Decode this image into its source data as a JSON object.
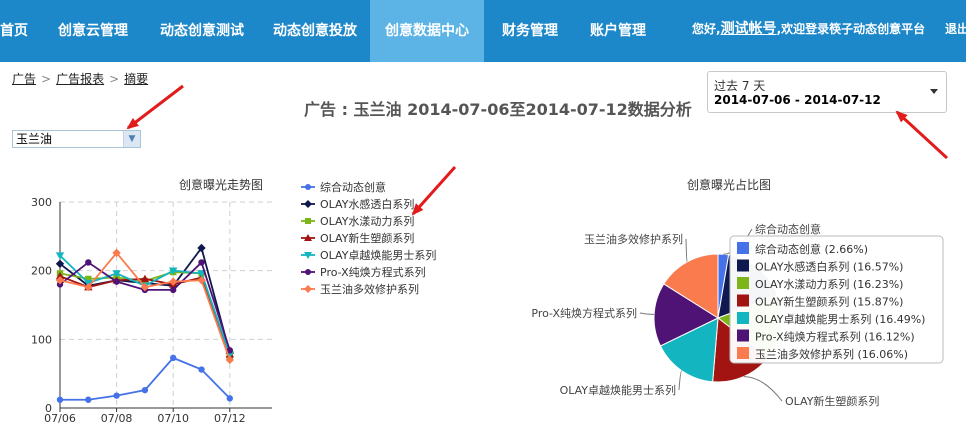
{
  "nav": {
    "items": [
      {
        "label": "首页"
      },
      {
        "label": "创意云管理"
      },
      {
        "label": "动态创意测试"
      },
      {
        "label": "动态创意投放"
      },
      {
        "label": "创意数据中心",
        "active": true
      },
      {
        "label": "财务管理"
      },
      {
        "label": "账户管理"
      }
    ],
    "greeting": "您好,",
    "account": "测试帐号",
    "welcome": ",欢迎登录筷子动态创意平台",
    "logout": "退出",
    "bar_color": "#1c87c9",
    "active_color": "#5cb4e6"
  },
  "breadcrumb": {
    "items": [
      "广告",
      "广告报表",
      "摘要"
    ],
    "separator": ">"
  },
  "page_title": "广告 : 玉兰油 2014-07-06至2014-07-12数据分析",
  "product_select": {
    "value": "玉兰油"
  },
  "date_range": {
    "preset": "过去 7 天",
    "range": "2014-07-06 - 2014-07-12"
  },
  "chart_data": [
    {
      "type": "line",
      "title": "创意曝光走势图",
      "x": [
        "07/06",
        "07/07",
        "07/08",
        "07/09",
        "07/10",
        "07/11",
        "07/12"
      ],
      "x_tick_labels": [
        "07/06",
        "07/08",
        "07/10",
        "07/12"
      ],
      "ylim": [
        0,
        300
      ],
      "y_ticks": [
        0,
        100,
        200,
        300
      ],
      "grid": true,
      "legend": "right",
      "series": [
        {
          "name": "综合动态创意",
          "color": "#4572e8",
          "marker": "circle",
          "values": [
            12,
            12,
            18,
            26,
            73,
            56,
            14
          ]
        },
        {
          "name": "OLAY水感透白系列",
          "color": "#10194f",
          "marker": "diamond",
          "values": [
            210,
            178,
            186,
            182,
            178,
            233,
            80
          ]
        },
        {
          "name": "OLAY水漾动力系列",
          "color": "#7bb51a",
          "marker": "square",
          "values": [
            196,
            188,
            190,
            185,
            198,
            196,
            76
          ]
        },
        {
          "name": "OLAY新生塑颜系列",
          "color": "#a11412",
          "marker": "triangle",
          "values": [
            192,
            176,
            186,
            188,
            180,
            190,
            78
          ]
        },
        {
          "name": "OLAY卓越焕能男士系列",
          "color": "#12b5c0",
          "marker": "triangle-down",
          "values": [
            222,
            182,
            196,
            178,
            200,
            196,
            78
          ]
        },
        {
          "name": "Pro-X纯焕方程式系列",
          "color": "#4f1275",
          "marker": "circle",
          "values": [
            180,
            212,
            184,
            172,
            172,
            212,
            84
          ]
        },
        {
          "name": "玉兰油多效修护系列",
          "color": "#fa7b4d",
          "marker": "diamond",
          "values": [
            186,
            176,
            226,
            176,
            184,
            186,
            70
          ]
        }
      ]
    },
    {
      "type": "pie",
      "title": "创意曝光占比图",
      "legend": "inside-right",
      "slices": [
        {
          "name": "综合动态创意",
          "value": 2.66,
          "label": "综合动态创意 (2.66%)",
          "color": "#4572e8"
        },
        {
          "name": "OLAY水感透白系列",
          "value": 16.57,
          "label": "OLAY水感透白系列 (16.57%)",
          "color": "#10194f"
        },
        {
          "name": "OLAY水漾动力系列",
          "value": 16.23,
          "label": "OLAY水漾动力系列 (16.23%)",
          "color": "#7bb51a"
        },
        {
          "name": "OLAY新生塑颜系列",
          "value": 15.87,
          "label": "OLAY新生塑颜系列 (15.87%)",
          "color": "#a11412"
        },
        {
          "name": "OLAY卓越焕能男士系列",
          "value": 16.49,
          "label": "OLAY卓越焕能男士系列 (16.49%)",
          "color": "#12b5c0"
        },
        {
          "name": "Pro-X纯焕方程式系列",
          "value": 16.12,
          "label": "Pro-X纯焕方程式系列 (16.12%)",
          "color": "#4f1275"
        },
        {
          "name": "玉兰油多效修护系列",
          "value": 16.06,
          "label": "玉兰油多效修护系列 (16.06%)",
          "color": "#fa7b4d"
        }
      ],
      "callouts": [
        "综合动态创意",
        "玉兰油多效修护系列",
        "Pro-X纯焕方程式系列",
        "OLAY卓越焕能男士系列",
        "OLAY新生塑颜系列"
      ]
    }
  ],
  "annotation_color": "#e21b1b"
}
